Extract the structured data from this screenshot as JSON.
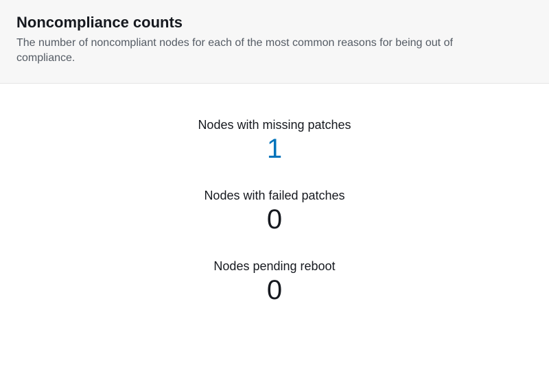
{
  "header": {
    "title": "Noncompliance counts",
    "description": "The number of noncompliant nodes for each of the most common reasons for being out of compliance."
  },
  "stats": [
    {
      "label": "Nodes with missing patches",
      "value": "1",
      "is_link": true
    },
    {
      "label": "Nodes with failed patches",
      "value": "0",
      "is_link": false
    },
    {
      "label": "Nodes pending reboot",
      "value": "0",
      "is_link": false
    }
  ]
}
